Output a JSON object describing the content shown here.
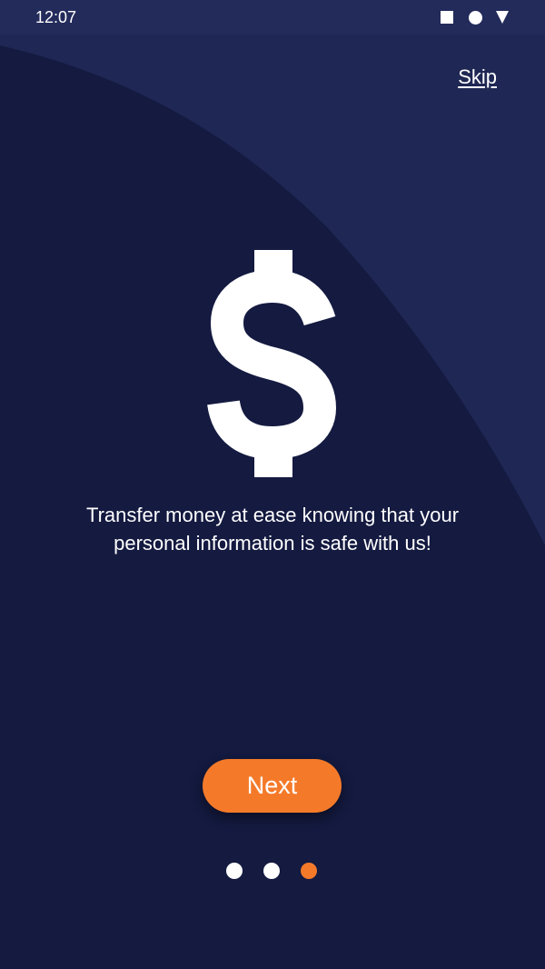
{
  "status_bar": {
    "time": "12:07",
    "icons": [
      "square-icon",
      "circle-icon",
      "triangle-icon"
    ]
  },
  "onboarding": {
    "skip_label": "Skip",
    "icon": "dollar-sign-icon",
    "message": "Transfer money at ease knowing that your personal information is safe with us!",
    "next_label": "Next",
    "pagination": {
      "total": 3,
      "current": 3
    }
  },
  "colors": {
    "background": "#141a40",
    "background_shape": "#232b5b",
    "accent": "#f47a2a",
    "text": "#ffffff"
  }
}
